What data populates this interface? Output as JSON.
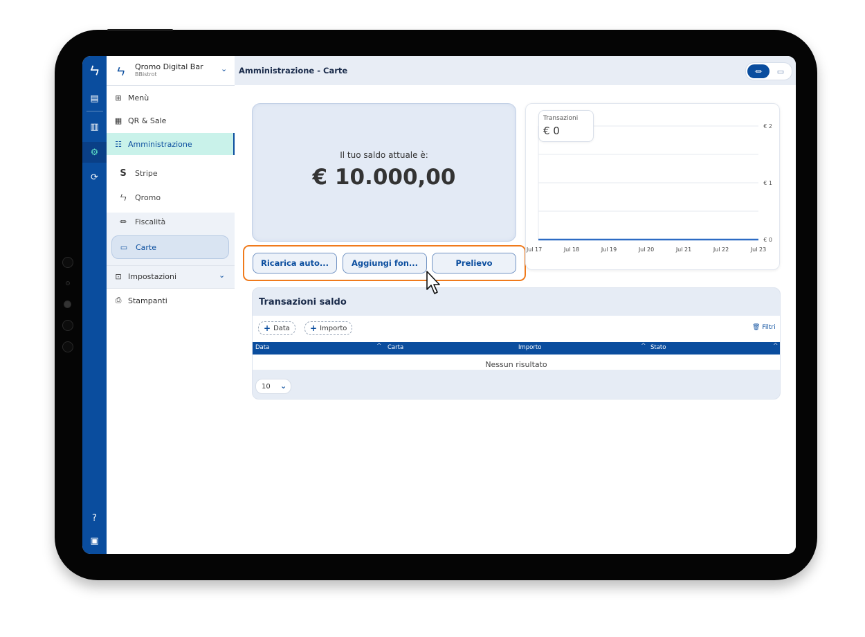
{
  "sidebar": {
    "brand": {
      "name": "Qromo Digital Bar",
      "subtitle": "BBistrot"
    },
    "nav": {
      "menu": "Menù",
      "qr": "QR & Sale",
      "admin": "Amministrazione",
      "stripe": "Stripe",
      "qromo": "Qromo",
      "fiscalita": "Fiscalità",
      "carte": "Carte",
      "impostazioni": "Impostazioni",
      "stampanti": "Stampanti"
    }
  },
  "header": {
    "title": "Amministrazione - Carte"
  },
  "balance": {
    "label": "Il tuo saldo attuale è:",
    "amount": "€ 10.000,00"
  },
  "actions": {
    "ricarica": "Ricarica auto...",
    "aggiungi": "Aggiungi fon...",
    "prelievo": "Prelievo"
  },
  "chart_data": {
    "type": "line",
    "title": "Transazioni",
    "summary": "€ 0",
    "x": [
      "Jul 17",
      "Jul 18",
      "Jul 19",
      "Jul 20",
      "Jul 21",
      "Jul 22",
      "Jul 23"
    ],
    "series": [
      {
        "values": [
          0,
          0,
          0,
          0,
          0,
          0,
          0
        ]
      }
    ],
    "y_ticks": [
      "€ 2",
      "€ 1",
      "€ 0"
    ],
    "ylim": [
      0,
      2
    ],
    "grid": true,
    "color": "#2c6bc4"
  },
  "transactions": {
    "title": "Transazioni saldo",
    "chips": [
      "Data",
      "Importo"
    ],
    "filter_label": "Filtri",
    "columns": [
      "Data",
      "Carta",
      "Importo",
      "Stato"
    ],
    "empty": "Nessun risultato",
    "page_size": "10"
  }
}
